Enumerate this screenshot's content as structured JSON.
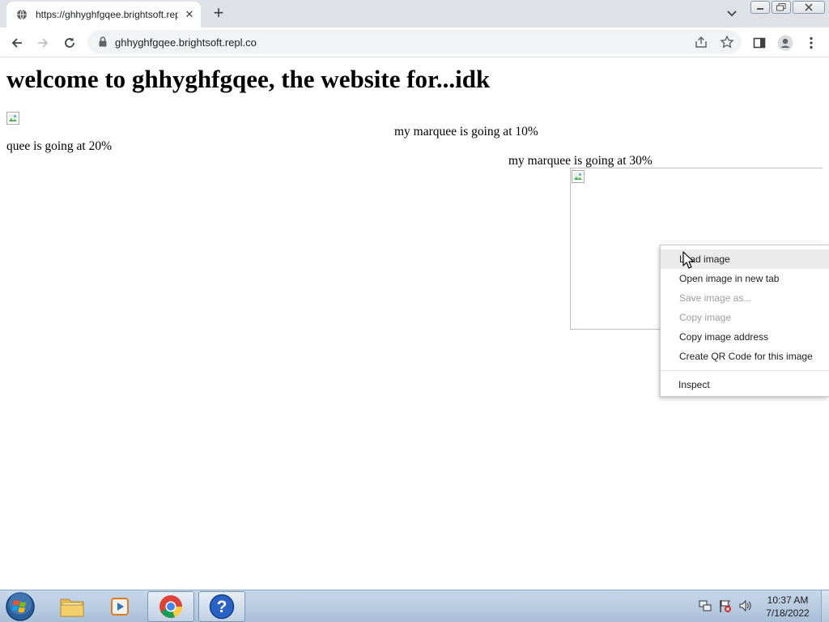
{
  "browser": {
    "tab_title": "https://ghhyghfgqee.brightsoft.repl.co",
    "url": "ghhyghfgqee.brightsoft.repl.co"
  },
  "page": {
    "heading": "welcome to ghhyghfgqee, the website for...idk",
    "marquee_10": "my marquee is going at 10%",
    "marquee_20": "quee is going at 20%",
    "marquee_30": "my marquee is going at 30%"
  },
  "context_menu": {
    "items": [
      {
        "label": "Load image",
        "state": "hover"
      },
      {
        "label": "Open image in new tab",
        "state": "enabled"
      },
      {
        "label": "Save image as...",
        "state": "disabled"
      },
      {
        "label": "Copy image",
        "state": "disabled"
      },
      {
        "label": "Copy image address",
        "state": "enabled"
      },
      {
        "label": "Create QR Code for this image",
        "state": "enabled"
      },
      {
        "label": "Inspect",
        "state": "enabled"
      }
    ]
  },
  "taskbar": {
    "apps": [
      "windows-explorer",
      "media-player",
      "chrome",
      "help-and-support"
    ],
    "clock_time": "10:37 AM",
    "clock_date": "7/18/2022"
  },
  "colors": {
    "tab_strip": "#dee1e6",
    "omnibox": "#f1f3f4",
    "menu_hover": "#ebebeb",
    "taskbar": "#a9bfd8"
  }
}
